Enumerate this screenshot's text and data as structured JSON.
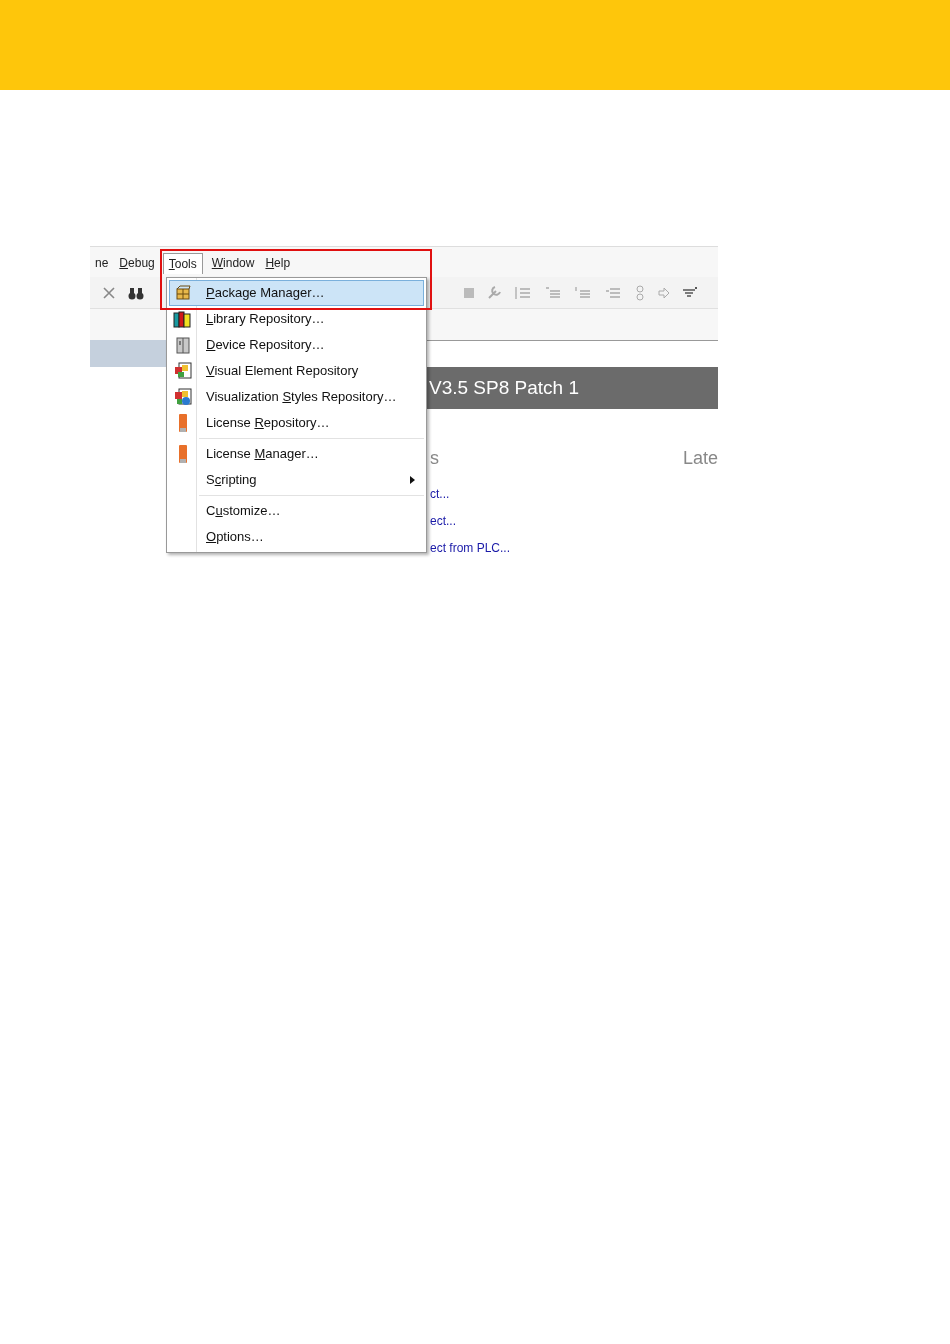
{
  "menubar": [
    {
      "text": {
        "pre": "ne"
      },
      "selected": false
    },
    {
      "text": {
        "key": "D",
        "post": "ebug"
      },
      "selected": false
    },
    {
      "text": {
        "key": "T",
        "post": "ools"
      },
      "selected": true
    },
    {
      "text": {
        "key": "W",
        "post": "indow"
      },
      "selected": false
    },
    {
      "text": {
        "key": "H",
        "post": "elp"
      },
      "selected": false
    }
  ],
  "menu": {
    "items": [
      {
        "kind": "item",
        "text": {
          "key": "P",
          "post": "ackage Manager…"
        },
        "selected": true
      },
      {
        "kind": "item",
        "text": {
          "key": "L",
          "post": "ibrary Repository…"
        },
        "selected": false
      },
      {
        "kind": "item",
        "text": {
          "key": "D",
          "post": "evice Repository…"
        },
        "selected": false
      },
      {
        "kind": "item",
        "text": {
          "key": "V",
          "post": "isual Element Repository"
        },
        "selected": false
      },
      {
        "kind": "item",
        "text": {
          "pre": "Visualization ",
          "key": "S",
          "post": "tyles Repository…"
        },
        "selected": false
      },
      {
        "kind": "item",
        "text": {
          "pre": "License ",
          "key": "R",
          "post": "epository…"
        },
        "selected": false
      },
      {
        "kind": "separator"
      },
      {
        "kind": "item",
        "text": {
          "pre": "License ",
          "key": "M",
          "post": "anager…"
        },
        "selected": false
      },
      {
        "kind": "submenu",
        "text": {
          "pre": "S",
          "key": "c",
          "post": "ripting"
        },
        "selected": false
      },
      {
        "kind": "separator"
      },
      {
        "kind": "item",
        "text": {
          "pre": "C",
          "key": "u",
          "post": "stomize…"
        },
        "selected": false
      },
      {
        "kind": "item",
        "text": {
          "key": "O",
          "post": "ptions…"
        },
        "selected": false
      }
    ]
  },
  "banner": "V3.5 SP8 Patch 1",
  "headings": [
    "s",
    "Late"
  ],
  "links": [
    "ct...",
    "ect...",
    "ect from PLC..."
  ]
}
